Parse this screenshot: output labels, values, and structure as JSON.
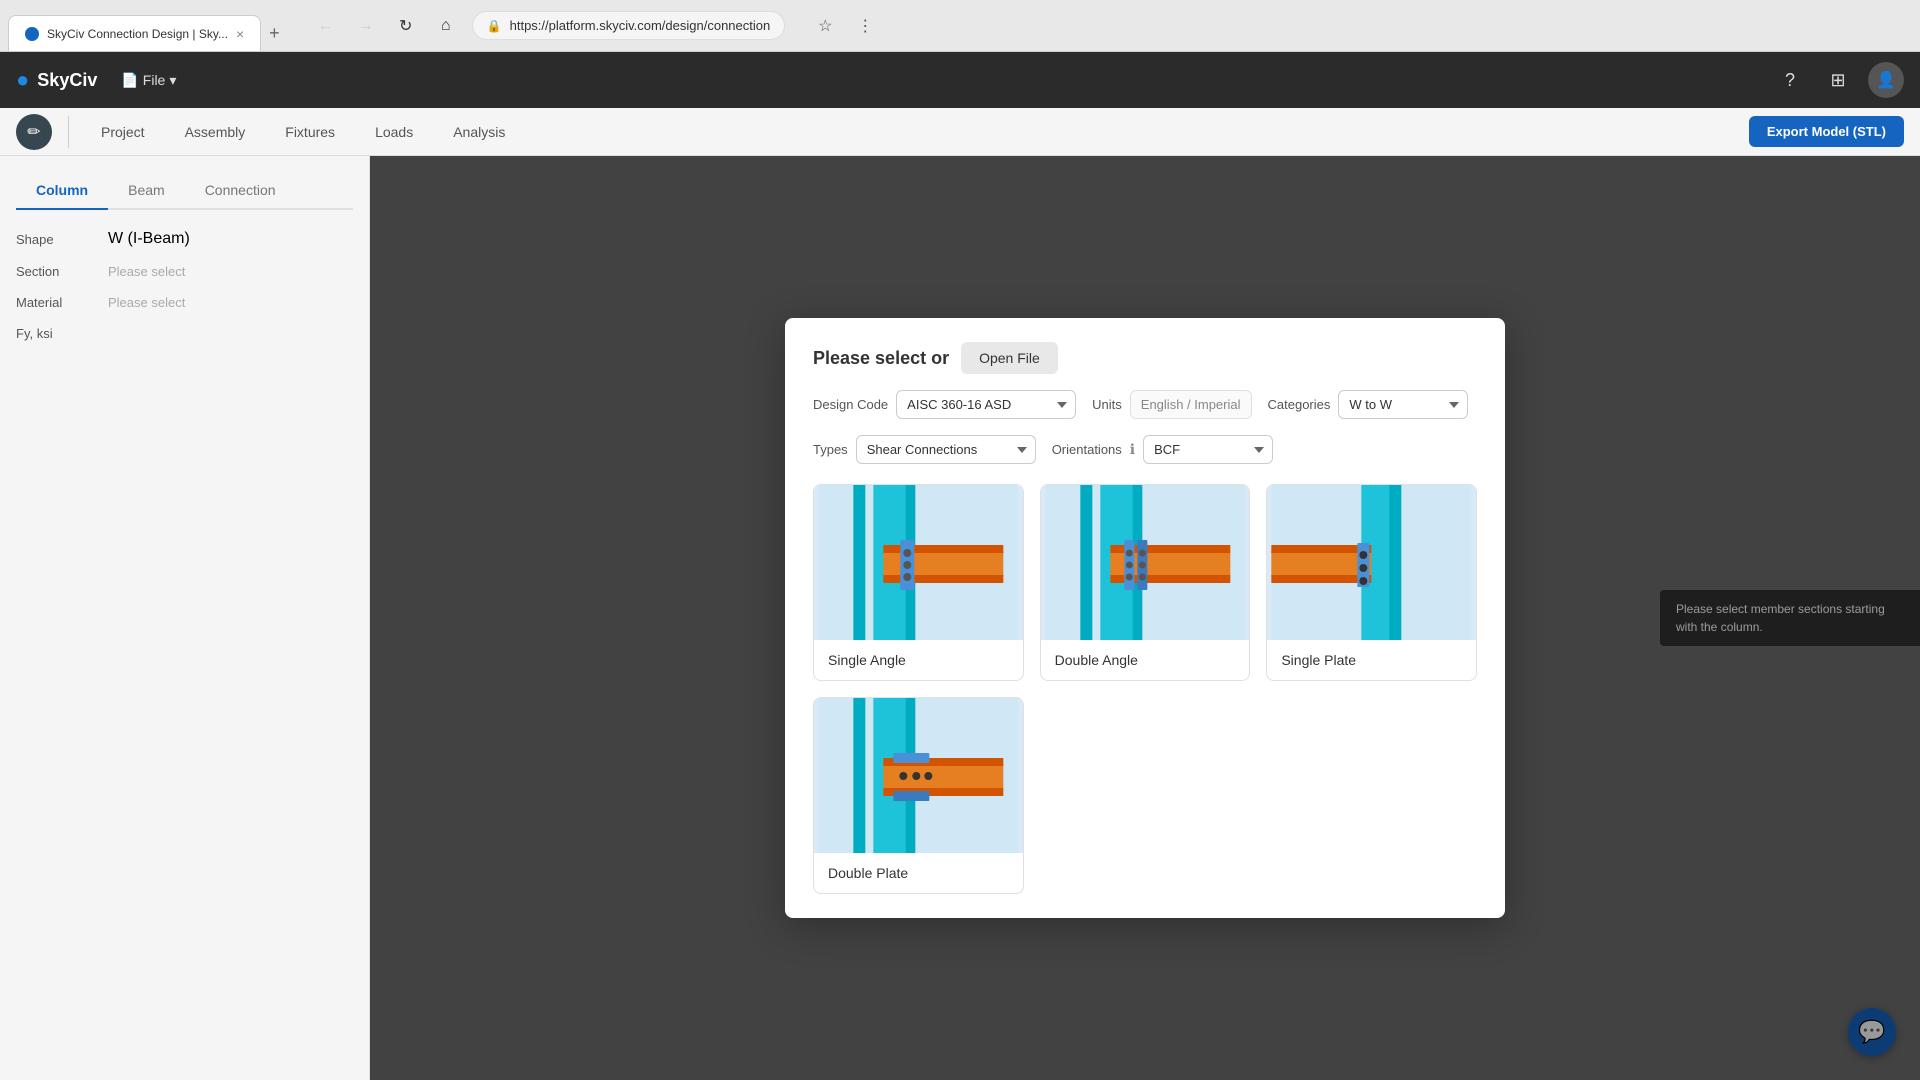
{
  "browser": {
    "tab_label": "SkyCiv Connection Design | Sky...",
    "tab_new_label": "+",
    "url": "https://platform.skyciv.com/design/connection",
    "back_title": "Back",
    "forward_title": "Forward",
    "refresh_title": "Refresh",
    "home_title": "Home"
  },
  "topnav": {
    "logo_text": "SkyCiv",
    "file_label": "File",
    "export_label": "Export Model (STL)"
  },
  "toolbar": {
    "tabs": [
      "Project",
      "Assembly",
      "Fixtures",
      "Loads",
      "Analysis"
    ]
  },
  "sidebar": {
    "tabs": [
      "Column",
      "Beam",
      "Connection"
    ],
    "active_tab": "Column",
    "fields": [
      {
        "label": "Shape",
        "value": "W (I-Beam)"
      },
      {
        "label": "Section",
        "placeholder": "Please select"
      },
      {
        "label": "Material",
        "placeholder": "Please select"
      },
      {
        "label": "Fy, ksi",
        "value": ""
      }
    ]
  },
  "content": {
    "tooltip": "Please select member sections starting with the column."
  },
  "modal": {
    "title": "Please select or",
    "open_file_label": "Open File",
    "design_code_label": "Design Code",
    "design_code_value": "AISC 360-16 ASD",
    "units_label": "Units",
    "units_value": "English / Imperial",
    "categories_label": "Categories",
    "categories_value": "W to W",
    "types_label": "Types",
    "types_value": "Shear Connections",
    "orientations_label": "Orientations",
    "orientations_value": "BCF",
    "connections": [
      {
        "label": "Single Angle",
        "type": "single-angle"
      },
      {
        "label": "Double Angle",
        "type": "double-angle"
      },
      {
        "label": "Single Plate",
        "type": "single-plate"
      },
      {
        "label": "Double Plate",
        "type": "double-plate"
      }
    ]
  },
  "chat": {
    "icon": "💬"
  }
}
